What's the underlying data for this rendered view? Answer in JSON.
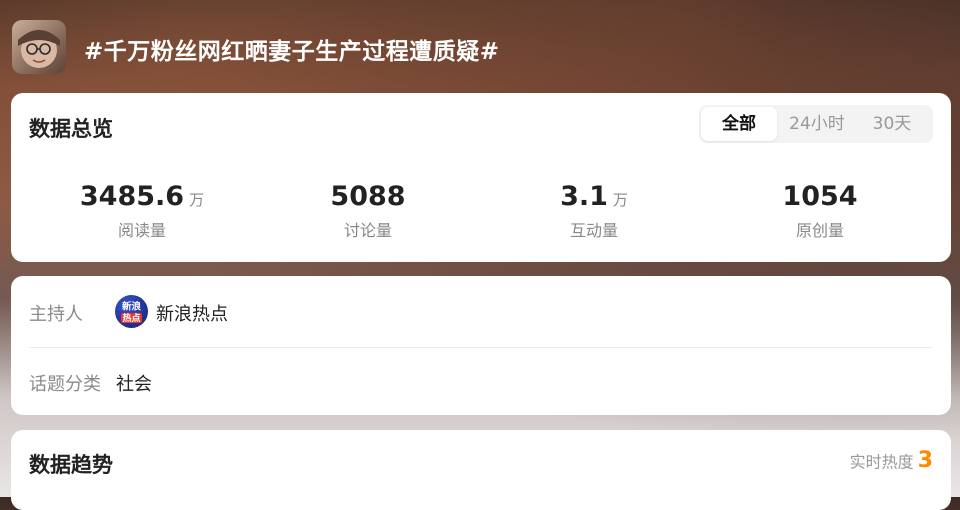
{
  "topic": {
    "title": "#千万粉丝网红晒妻子生产过程遭质疑#",
    "avatar_icon": "person-photo-avatar"
  },
  "overview": {
    "title": "数据总览",
    "tabs": [
      {
        "label": "全部",
        "selected": true
      },
      {
        "label": "24小时",
        "selected": false
      },
      {
        "label": "30天",
        "selected": false
      }
    ],
    "stats": [
      {
        "value": "3485.6",
        "unit": "万",
        "label": "阅读量"
      },
      {
        "value": "5088",
        "unit": "",
        "label": "讨论量"
      },
      {
        "value": "3.1",
        "unit": "万",
        "label": "互动量"
      },
      {
        "value": "1054",
        "unit": "",
        "label": "原创量"
      }
    ]
  },
  "info": {
    "host_label": "主持人",
    "host_name": "新浪热点",
    "host_badge_text": [
      "新浪",
      "热点"
    ],
    "category_label": "话题分类",
    "category_value": "社会"
  },
  "trend": {
    "title": "数据趋势",
    "heat_label": "实时热度",
    "heat_value": "3"
  },
  "colors": {
    "accent": "#ff8a00",
    "badge_blue": "#1b2d8e"
  }
}
